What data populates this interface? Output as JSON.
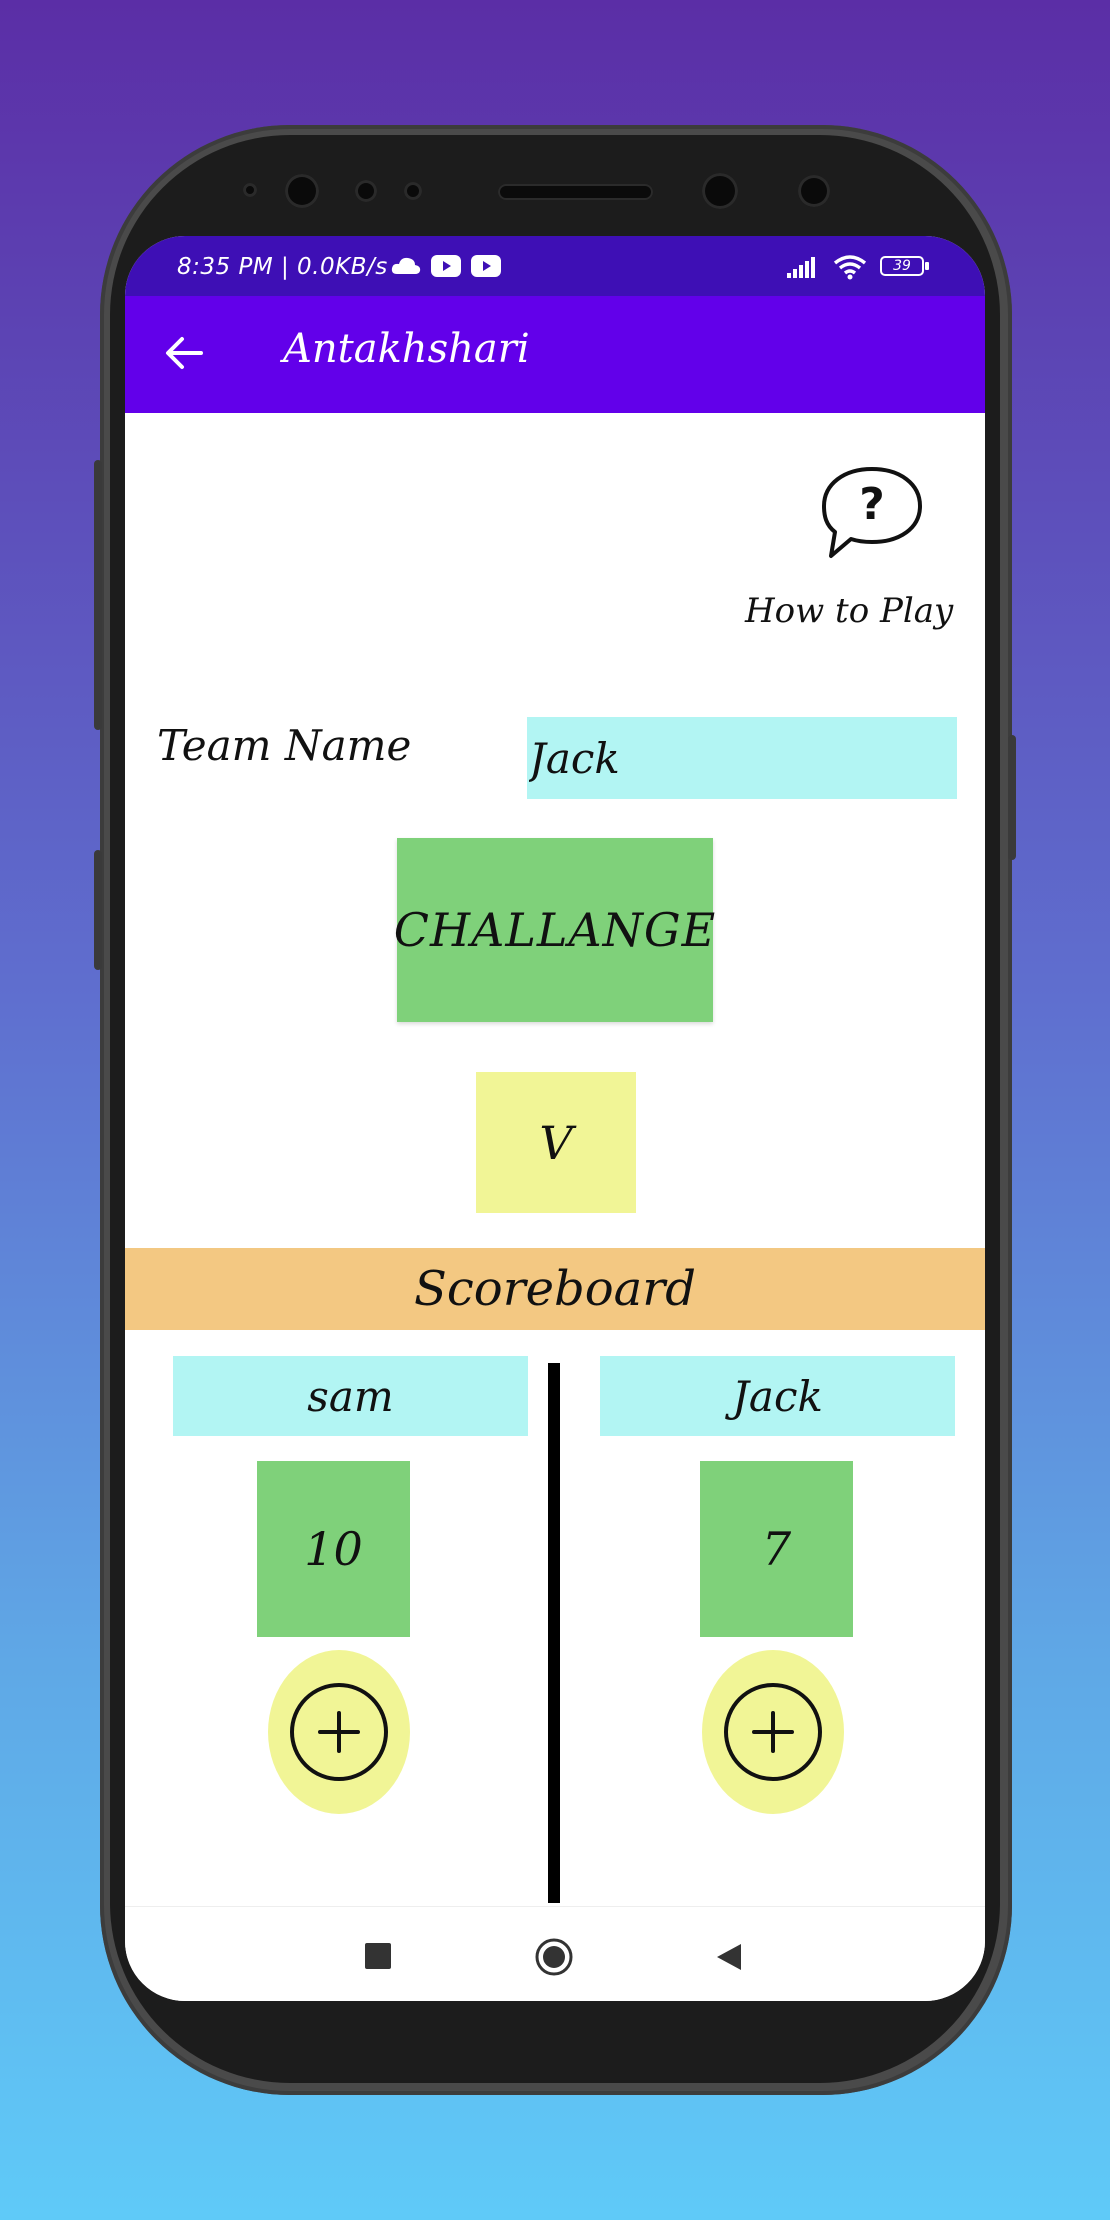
{
  "status_bar": {
    "time_speed": "8:35 PM | 0.0KB/s",
    "battery": "39"
  },
  "app_bar": {
    "title": "Antakhshari"
  },
  "help": {
    "label": "How to Play"
  },
  "team": {
    "label": "Team Name",
    "value": "Jack"
  },
  "challenge_button": "CHALLANGE",
  "letter": "V",
  "scoreboard": {
    "title": "Scoreboard",
    "teams": [
      {
        "name": "sam",
        "score": "10"
      },
      {
        "name": "Jack",
        "score": "7"
      }
    ]
  },
  "colors": {
    "status_bar": "#3e0fb5",
    "app_bar": "#6200ea",
    "cyan": "#b2f5f3",
    "green": "#7fd17a",
    "yellow": "#f1f596",
    "orange": "#f3c882"
  }
}
